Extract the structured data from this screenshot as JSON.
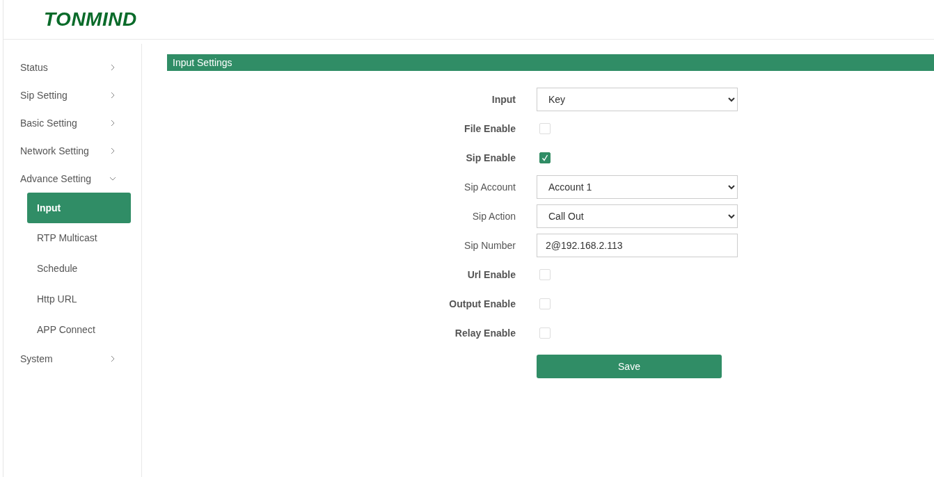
{
  "header": {
    "logo": "TONMIND"
  },
  "sidebar": {
    "items": [
      {
        "label": "Status",
        "expanded": false
      },
      {
        "label": "Sip Setting",
        "expanded": false
      },
      {
        "label": "Basic Setting",
        "expanded": false
      },
      {
        "label": "Network Setting",
        "expanded": false
      },
      {
        "label": "Advance Setting",
        "expanded": true,
        "children": [
          {
            "label": "Input",
            "selected": true
          },
          {
            "label": "RTP Multicast",
            "selected": false
          },
          {
            "label": "Schedule",
            "selected": false
          },
          {
            "label": "Http URL",
            "selected": false
          },
          {
            "label": "APP Connect",
            "selected": false
          }
        ]
      },
      {
        "label": "System",
        "expanded": false
      }
    ]
  },
  "panel": {
    "title": "Input Settings",
    "fields": [
      {
        "label": "Input",
        "label_bold": true,
        "kind": "select",
        "value": "Key"
      },
      {
        "label": "File Enable",
        "label_bold": true,
        "kind": "checkbox",
        "checked": false
      },
      {
        "label": "Sip Enable",
        "label_bold": true,
        "kind": "checkbox",
        "checked": true
      },
      {
        "label": "Sip Account",
        "label_bold": false,
        "kind": "select",
        "value": "Account 1"
      },
      {
        "label": "Sip Action",
        "label_bold": false,
        "kind": "select",
        "value": "Call Out"
      },
      {
        "label": "Sip Number",
        "label_bold": false,
        "kind": "text",
        "value": "2@192.168.2.113"
      },
      {
        "label": "Url Enable",
        "label_bold": true,
        "kind": "checkbox",
        "checked": false
      },
      {
        "label": "Output Enable",
        "label_bold": true,
        "kind": "checkbox",
        "checked": false
      },
      {
        "label": "Relay Enable",
        "label_bold": true,
        "kind": "checkbox",
        "checked": false
      }
    ],
    "save_button": "Save"
  }
}
